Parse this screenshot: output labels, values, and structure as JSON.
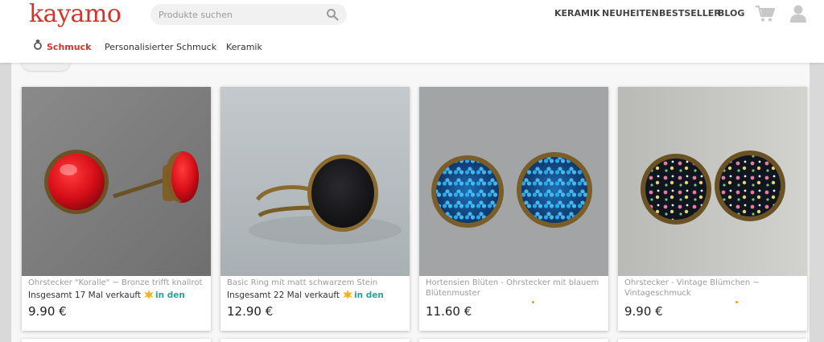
{
  "brand": {
    "name": "kayamo",
    "color": "#d7312a"
  },
  "search": {
    "placeholder": "Produkte suchen",
    "icon": "search-icon"
  },
  "topnav": [
    "KERAMIK",
    "NEUHEITEN",
    "BESTSELLER",
    "BLOG"
  ],
  "icons": {
    "cart": "cart-icon",
    "user": "user-icon",
    "category": "ring-icon"
  },
  "subnav": [
    {
      "label": "Schmuck",
      "active": true
    },
    {
      "label": "Personalisierter Schmuck",
      "active": false
    },
    {
      "label": "Keramik",
      "active": false
    }
  ],
  "products": [
    {
      "name": "Ohrstecker \"Koralle\" ~ Bronze trifft knallrot",
      "sold": "Insgesamt 17 Mal verkauft",
      "stock": "in den",
      "price": "9.90 €"
    },
    {
      "name": "Basic Ring mit matt schwarzem Stein",
      "sold": "Insgesamt 22 Mal verkauft",
      "stock": "in den",
      "price": "12.90 €"
    },
    {
      "name": "Hortensien Blüten - Ohrstecker mit blauem Blütenmuster",
      "sold": "",
      "stock": "",
      "price": "11.60 €"
    },
    {
      "name": "Ohrstecker - Vintage Blümchen ~ Vintageschmuck",
      "sold": "",
      "stock": "",
      "price": "9.90 €"
    }
  ],
  "colors": {
    "accent": "#d7312a",
    "stock": "#2aa198",
    "background": "#d9d9d9"
  }
}
